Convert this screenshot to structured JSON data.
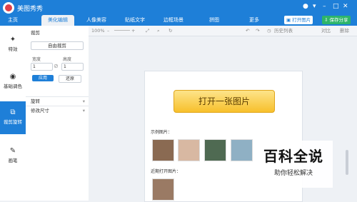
{
  "app": {
    "name": "美图秀秀"
  },
  "tabs": [
    "主页",
    "美化编辑",
    "人像美容",
    "贴纸文字",
    "边框场景",
    "拼图",
    "更多"
  ],
  "header": {
    "open_image": "打开图片",
    "save_share": "保存分享"
  },
  "sidebar": {
    "items": [
      {
        "label": "特效",
        "icon": "magic-wand-icon"
      },
      {
        "label": "基础调色",
        "icon": "palette-icon"
      },
      {
        "label": "裁剪旋转",
        "icon": "crop-icon"
      },
      {
        "label": "画笔",
        "icon": "brush-icon"
      }
    ]
  },
  "panel": {
    "crop_title": "裁剪",
    "crop_mode": "自由裁剪",
    "width_label": "宽度",
    "height_label": "高度",
    "width_value": "1",
    "height_value": "1",
    "apply_label": "应用",
    "restore_label": "还原",
    "rotate_label": "旋转",
    "resize_label": "修改尺寸"
  },
  "toolbar": {
    "zoom": "100%",
    "history": "历史列表",
    "compare": "对比",
    "delete": "删除"
  },
  "canvas": {
    "open_button": "打开一张图片",
    "examples_label": "示例图片：",
    "recent_label": "近期打开图片："
  },
  "watermark": {
    "title": "百科全说",
    "subtitle": "助你轻松解决"
  },
  "colors": {
    "primary": "#1e7fd8",
    "save_button": "#2db56a",
    "open_button": "#f7c02c"
  }
}
